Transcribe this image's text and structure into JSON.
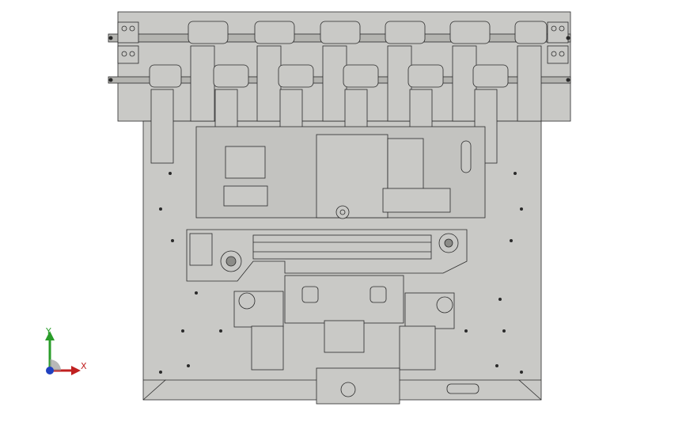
{
  "viewport": {
    "background": "#ffffff",
    "part_fill": "#c9c9c6",
    "part_stroke": "#2a2a2a",
    "shade_fill": "#b4b4b0",
    "dark_fill": "#8c8c88"
  },
  "triad": {
    "x_label": "X",
    "y_label": "Y",
    "x_color": "#c02020",
    "y_color": "#2a9d2a",
    "z_color": "#2040c0",
    "origin_icon": "triad-origin-icon"
  }
}
